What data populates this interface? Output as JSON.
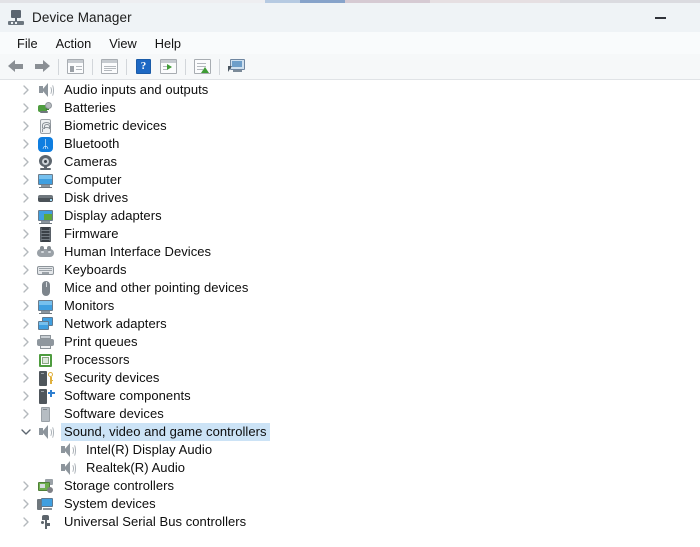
{
  "window": {
    "title": "Device Manager",
    "icon": "device-manager-icon",
    "minimize_label": "—"
  },
  "menubar": {
    "items": [
      {
        "label": "File"
      },
      {
        "label": "Action"
      },
      {
        "label": "View"
      },
      {
        "label": "Help"
      }
    ]
  },
  "toolbar": {
    "buttons": [
      {
        "name": "back-button",
        "icon": "back-arrow-icon",
        "enabled": false
      },
      {
        "name": "forward-button",
        "icon": "forward-arrow-icon",
        "enabled": false
      },
      {
        "name": "show-hide-console-tree-button",
        "icon": "console-tree-icon",
        "enabled": false
      },
      {
        "name": "properties-button",
        "icon": "properties-icon",
        "enabled": false
      },
      {
        "name": "help-button",
        "icon": "help-question-icon",
        "enabled": true
      },
      {
        "name": "update-driver-button",
        "icon": "update-driver-icon",
        "enabled": false
      },
      {
        "name": "scan-for-hardware-changes-button",
        "icon": "scan-hardware-icon",
        "enabled": false
      },
      {
        "name": "display-device-button",
        "icon": "display-device-icon",
        "enabled": false
      }
    ]
  },
  "tree": {
    "nodes": [
      {
        "label": "Audio inputs and outputs",
        "icon": "speaker-icon",
        "level": 0,
        "expanded": false,
        "selected": false
      },
      {
        "label": "Batteries",
        "icon": "battery-icon",
        "level": 0,
        "expanded": false,
        "selected": false
      },
      {
        "label": "Biometric devices",
        "icon": "fingerprint-icon",
        "level": 0,
        "expanded": false,
        "selected": false
      },
      {
        "label": "Bluetooth",
        "icon": "bluetooth-icon",
        "level": 0,
        "expanded": false,
        "selected": false
      },
      {
        "label": "Cameras",
        "icon": "camera-icon",
        "level": 0,
        "expanded": false,
        "selected": false
      },
      {
        "label": "Computer",
        "icon": "computer-monitor-icon",
        "level": 0,
        "expanded": false,
        "selected": false
      },
      {
        "label": "Disk drives",
        "icon": "disk-drive-icon",
        "level": 0,
        "expanded": false,
        "selected": false
      },
      {
        "label": "Display adapters",
        "icon": "display-adapter-icon",
        "level": 0,
        "expanded": false,
        "selected": false
      },
      {
        "label": "Firmware",
        "icon": "firmware-chip-icon",
        "level": 0,
        "expanded": false,
        "selected": false
      },
      {
        "label": "Human Interface Devices",
        "icon": "hid-gamepad-icon",
        "level": 0,
        "expanded": false,
        "selected": false
      },
      {
        "label": "Keyboards",
        "icon": "keyboard-icon",
        "level": 0,
        "expanded": false,
        "selected": false
      },
      {
        "label": "Mice and other pointing devices",
        "icon": "mouse-icon",
        "level": 0,
        "expanded": false,
        "selected": false
      },
      {
        "label": "Monitors",
        "icon": "computer-monitor-icon",
        "level": 0,
        "expanded": false,
        "selected": false
      },
      {
        "label": "Network adapters",
        "icon": "network-adapter-icon",
        "level": 0,
        "expanded": false,
        "selected": false
      },
      {
        "label": "Print queues",
        "icon": "printer-icon",
        "level": 0,
        "expanded": false,
        "selected": false
      },
      {
        "label": "Processors",
        "icon": "processor-chip-icon",
        "level": 0,
        "expanded": false,
        "selected": false
      },
      {
        "label": "Security devices",
        "icon": "security-key-icon",
        "level": 0,
        "expanded": false,
        "selected": false
      },
      {
        "label": "Software components",
        "icon": "software-component-icon",
        "level": 0,
        "expanded": false,
        "selected": false
      },
      {
        "label": "Software devices",
        "icon": "software-device-icon",
        "level": 0,
        "expanded": false,
        "selected": false
      },
      {
        "label": "Sound, video and game controllers",
        "icon": "speaker-icon",
        "level": 0,
        "expanded": true,
        "selected": true
      },
      {
        "label": "Intel(R) Display Audio",
        "icon": "speaker-icon",
        "level": 1,
        "expanded": false,
        "selected": false
      },
      {
        "label": "Realtek(R) Audio",
        "icon": "speaker-icon",
        "level": 1,
        "expanded": false,
        "selected": false
      },
      {
        "label": "Storage controllers",
        "icon": "storage-controller-icon",
        "level": 0,
        "expanded": false,
        "selected": false
      },
      {
        "label": "System devices",
        "icon": "system-device-icon",
        "level": 0,
        "expanded": false,
        "selected": false
      },
      {
        "label": "Universal Serial Bus controllers",
        "icon": "usb-icon",
        "level": 0,
        "expanded": false,
        "selected": false
      }
    ]
  },
  "colors": {
    "titlebar_bg": "#eff3f6",
    "menubar_bg": "#f9fbfc",
    "toolbar_bg": "#f6f8f9",
    "selection_bg": "#cce3f6",
    "text": "#0d0d0d",
    "chevron": "#b8bcc0",
    "accent_blue": "#0f7ee0",
    "accent_green": "#4e9c3f"
  }
}
